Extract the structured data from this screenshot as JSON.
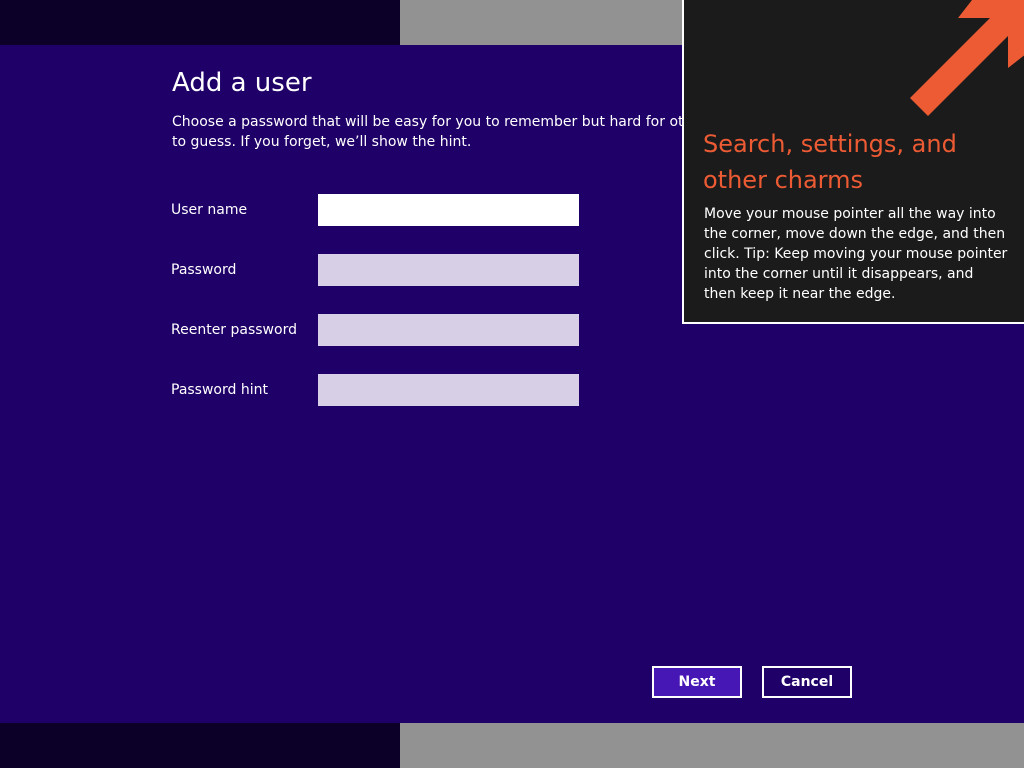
{
  "dialog": {
    "title": "Add a user",
    "description": "Choose a password that will be easy for you to remember but hard for others to guess. If you forget, we’ll show the hint.",
    "fields": [
      {
        "label": "User name",
        "value": ""
      },
      {
        "label": "Password",
        "value": ""
      },
      {
        "label": "Reenter password",
        "value": ""
      },
      {
        "label": "Password hint",
        "value": ""
      }
    ],
    "buttons": {
      "next_label": "Next",
      "cancel_label": "Cancel"
    }
  },
  "charms_tip": {
    "title": "Search, settings, and other charms",
    "body": "Move your mouse pointer all the way into the corner, move down the edge, and then click. Tip: Keep moving your mouse pointer into the corner until it disappears, and then keep it near the edge.",
    "arrow_icon": "arrow-up-right-icon"
  },
  "colors": {
    "dialog_background": "#1f0068",
    "accent_button": "#4617b4",
    "tip_background": "#1b1b1b",
    "tip_accent": "#ec5b34",
    "inactive_field": "#d6cfe6",
    "backdrop_gray": "#929292",
    "backdrop_dark": "#0c0028"
  }
}
